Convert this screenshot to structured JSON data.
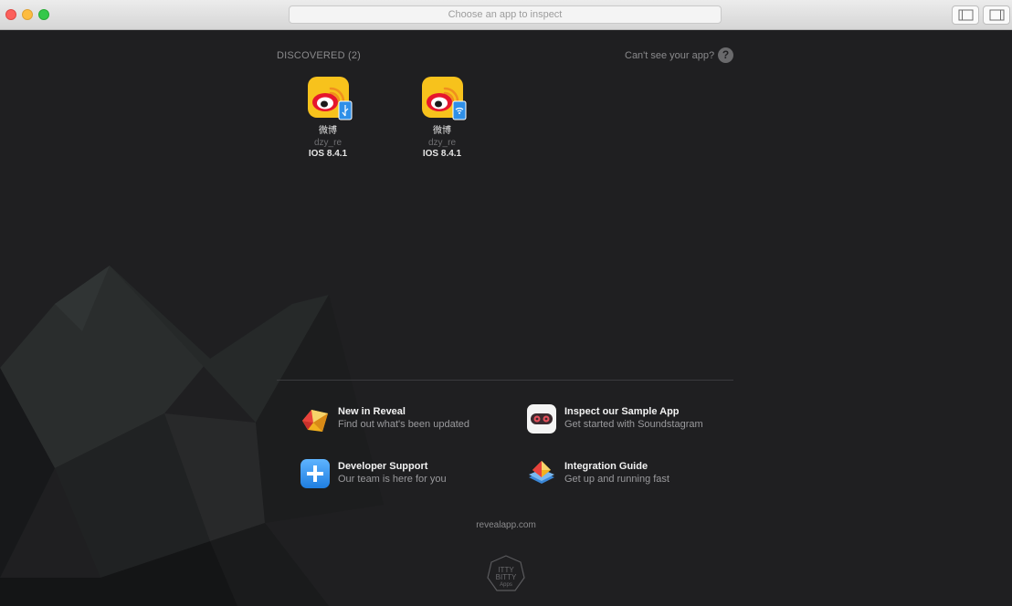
{
  "window": {
    "search_placeholder": "Choose an app to inspect"
  },
  "discovered": {
    "label": "DISCOVERED (2)",
    "help_text": "Can't see your app?",
    "help_icon": "?",
    "apps": [
      {
        "name": "微博",
        "device": "dzy_re",
        "os": "IOS 8.4.1",
        "connection": "usb-icon"
      },
      {
        "name": "微博",
        "device": "dzy_re",
        "os": "IOS 8.4.1",
        "connection": "wifi-icon"
      }
    ]
  },
  "links": [
    {
      "title": "New in Reveal",
      "subtitle": "Find out what's been updated",
      "icon": "reveal-logo-icon"
    },
    {
      "title": "Inspect our Sample App",
      "subtitle": "Get started with Soundstagram",
      "icon": "soundstagram-icon"
    },
    {
      "title": "Developer Support",
      "subtitle": "Our team is here for you",
      "icon": "plus-icon"
    },
    {
      "title": "Integration Guide",
      "subtitle": "Get up and running fast",
      "icon": "integration-guide-icon"
    }
  ],
  "footer": {
    "site": "revealapp.com",
    "logo_text": "ITTY BITTY Apps"
  },
  "colors": {
    "background": "#1f1f21",
    "app_icon_yellow": "#f7c21c",
    "weibo_red": "#e6162d",
    "badge_blue": "#2f8fe8"
  }
}
